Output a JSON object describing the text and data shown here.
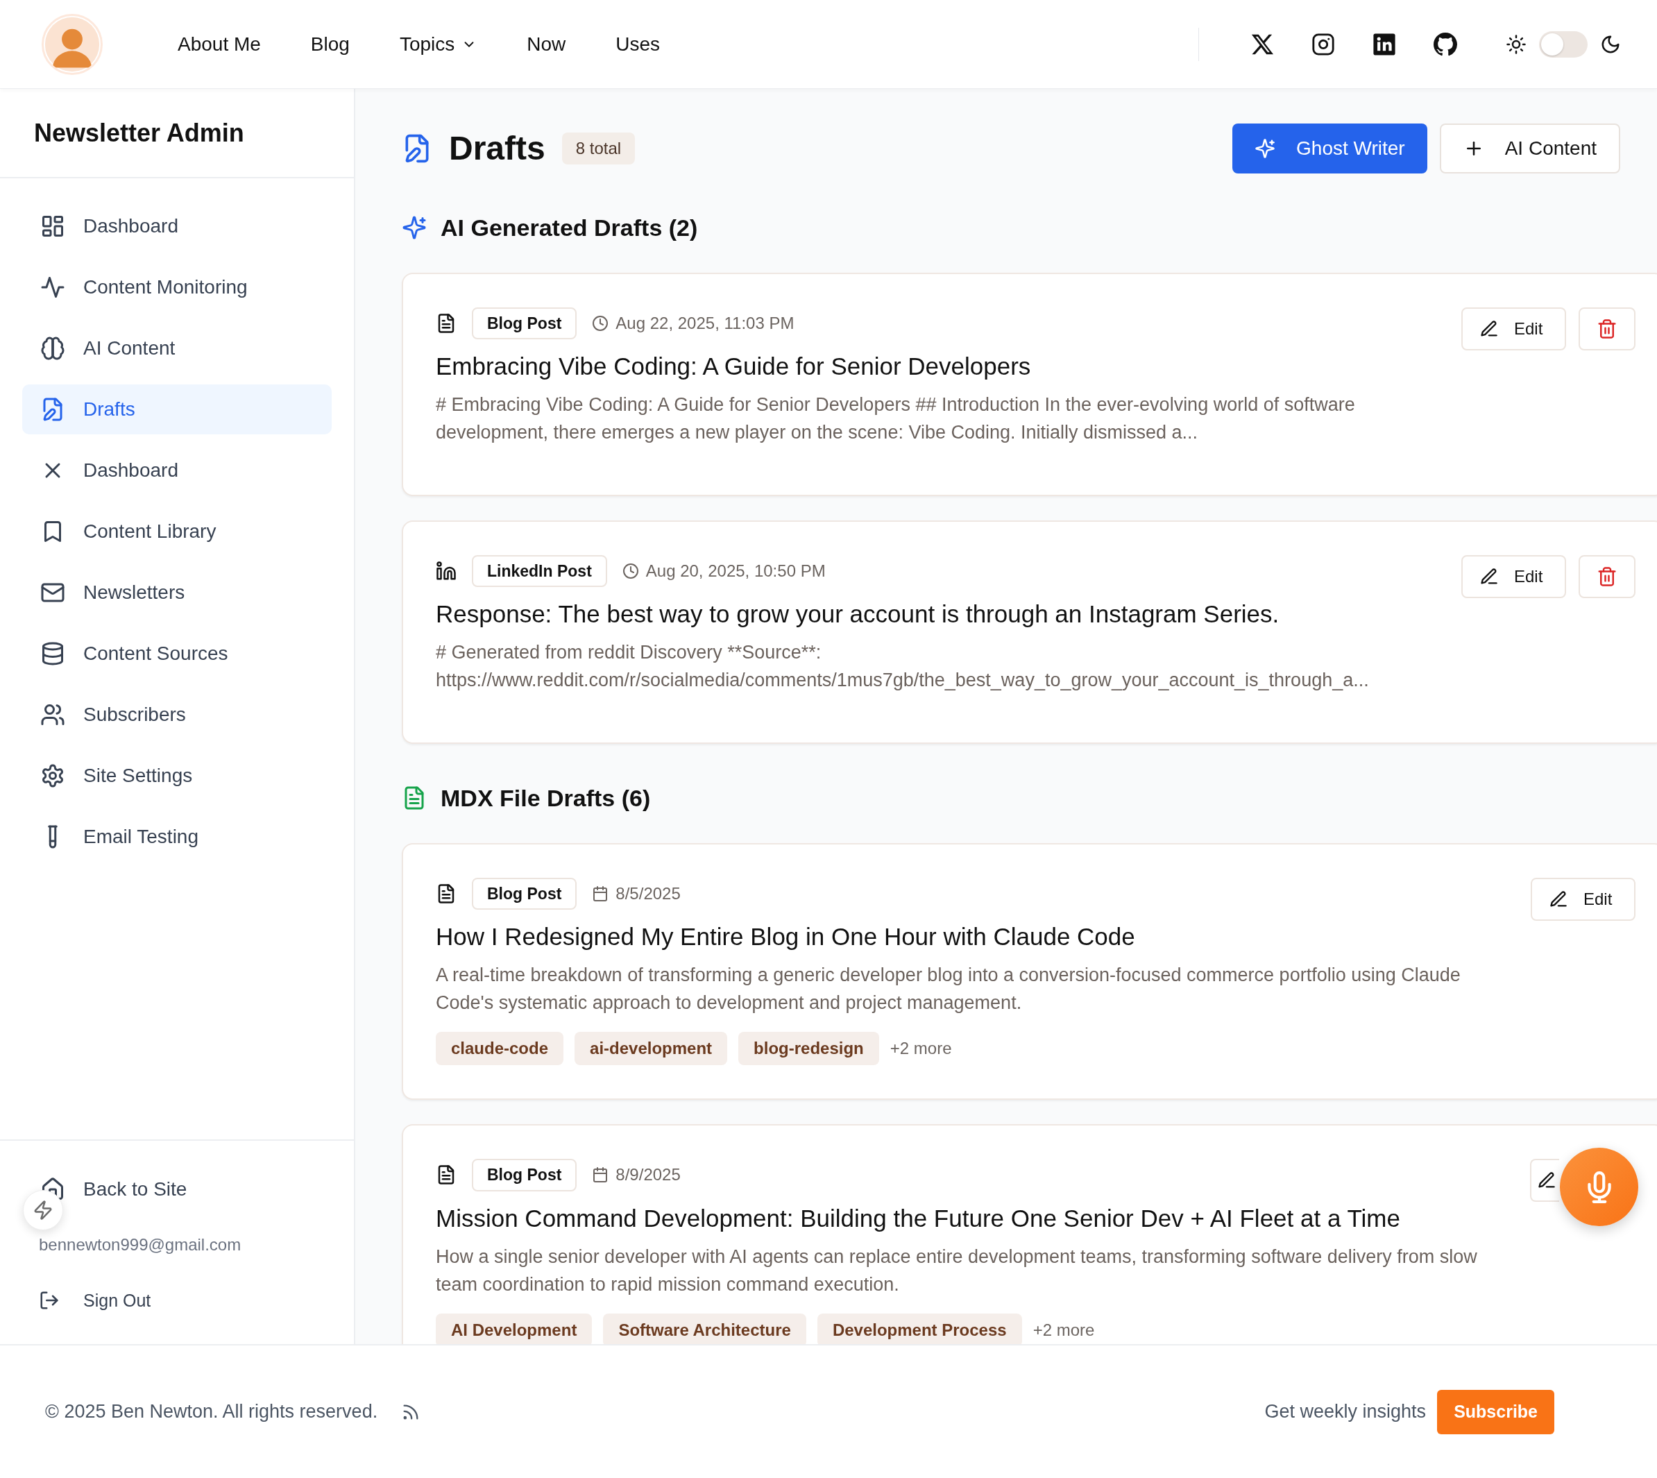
{
  "header": {
    "nav": [
      {
        "label": "About Me",
        "dropdown": false
      },
      {
        "label": "Blog",
        "dropdown": false
      },
      {
        "label": "Topics",
        "dropdown": true
      },
      {
        "label": "Now",
        "dropdown": false
      },
      {
        "label": "Uses",
        "dropdown": false
      }
    ],
    "dark_mode": false
  },
  "sidebar": {
    "title": "Newsletter Admin",
    "items": [
      {
        "label": "Dashboard",
        "selected": false
      },
      {
        "label": "Content Monitoring",
        "selected": false
      },
      {
        "label": "AI Content",
        "selected": false
      },
      {
        "label": "Drafts",
        "selected": true
      },
      {
        "label": "Dashboard",
        "selected": false
      },
      {
        "label": "Content Library",
        "selected": false
      },
      {
        "label": "Newsletters",
        "selected": false
      },
      {
        "label": "Content Sources",
        "selected": false
      },
      {
        "label": "Subscribers",
        "selected": false
      },
      {
        "label": "Site Settings",
        "selected": false
      },
      {
        "label": "Email Testing",
        "selected": false
      }
    ],
    "back_label": "Back to Site",
    "email": "bennewton999@gmail.com",
    "sign_out": "Sign Out"
  },
  "main": {
    "title": "Drafts",
    "count": "8 total",
    "buttons": [
      {
        "label": "Ghost Writer",
        "kind": "primary"
      },
      {
        "label": "AI Content",
        "kind": "secondary"
      }
    ],
    "sections": [
      {
        "kind": "ai",
        "title": "AI Generated Drafts (2)",
        "drafts": [
          {
            "kind": "blog",
            "type": "Blog Post",
            "date": "Aug 22, 2025, 11:03 PM",
            "title": "Embracing Vibe Coding: A Guide for Senior Developers",
            "excerpt": "# Embracing Vibe Coding: A Guide for Senior Developers ## Introduction In the ever-evolving world of software development, there emerges a new player on the scene: Vibe Coding. Initially dismissed a...",
            "edit": "Edit",
            "deletable": true
          },
          {
            "kind": "linkedin",
            "type": "LinkedIn Post",
            "date": "Aug 20, 2025, 10:50 PM",
            "title": "Response: The best way to grow your account is through an Instagram Series.",
            "excerpt": "# Generated from reddit Discovery **Source**: https://www.reddit.com/r/socialmedia/comments/1mus7gb/the_best_way_to_grow_your_account_is_through_a...",
            "edit": "Edit",
            "deletable": true
          }
        ]
      },
      {
        "kind": "mdx",
        "title": "MDX File Drafts (6)",
        "drafts": [
          {
            "kind": "blog",
            "type": "Blog Post",
            "date": "8/5/2025",
            "title": "How I Redesigned My Entire Blog in One Hour with Claude Code",
            "excerpt": "A real-time breakdown of transforming a generic developer blog into a conversion-focused commerce portfolio using Claude Code's systematic approach to development and project management.",
            "tags": [
              "claude-code",
              "ai-development",
              "blog-redesign"
            ],
            "more": "+2 more",
            "edit": "Edit",
            "deletable": false
          },
          {
            "kind": "blog",
            "type": "Blog Post",
            "date": "8/9/2025",
            "title": "Mission Command Development: Building the Future One Senior Dev + AI Fleet at a Time",
            "excerpt": "How a single senior developer with AI agents can replace entire development teams, transforming software delivery from slow team coordination to rapid mission command execution.",
            "tags": [
              "AI Development",
              "Software Architecture",
              "Development Process"
            ],
            "more": "+2 more",
            "deletable": false
          }
        ]
      }
    ]
  },
  "footer": {
    "copyright": "© 2025 Ben Newton. All rights reserved.",
    "tagline": "Get weekly insights",
    "subscribe": "Subscribe"
  }
}
